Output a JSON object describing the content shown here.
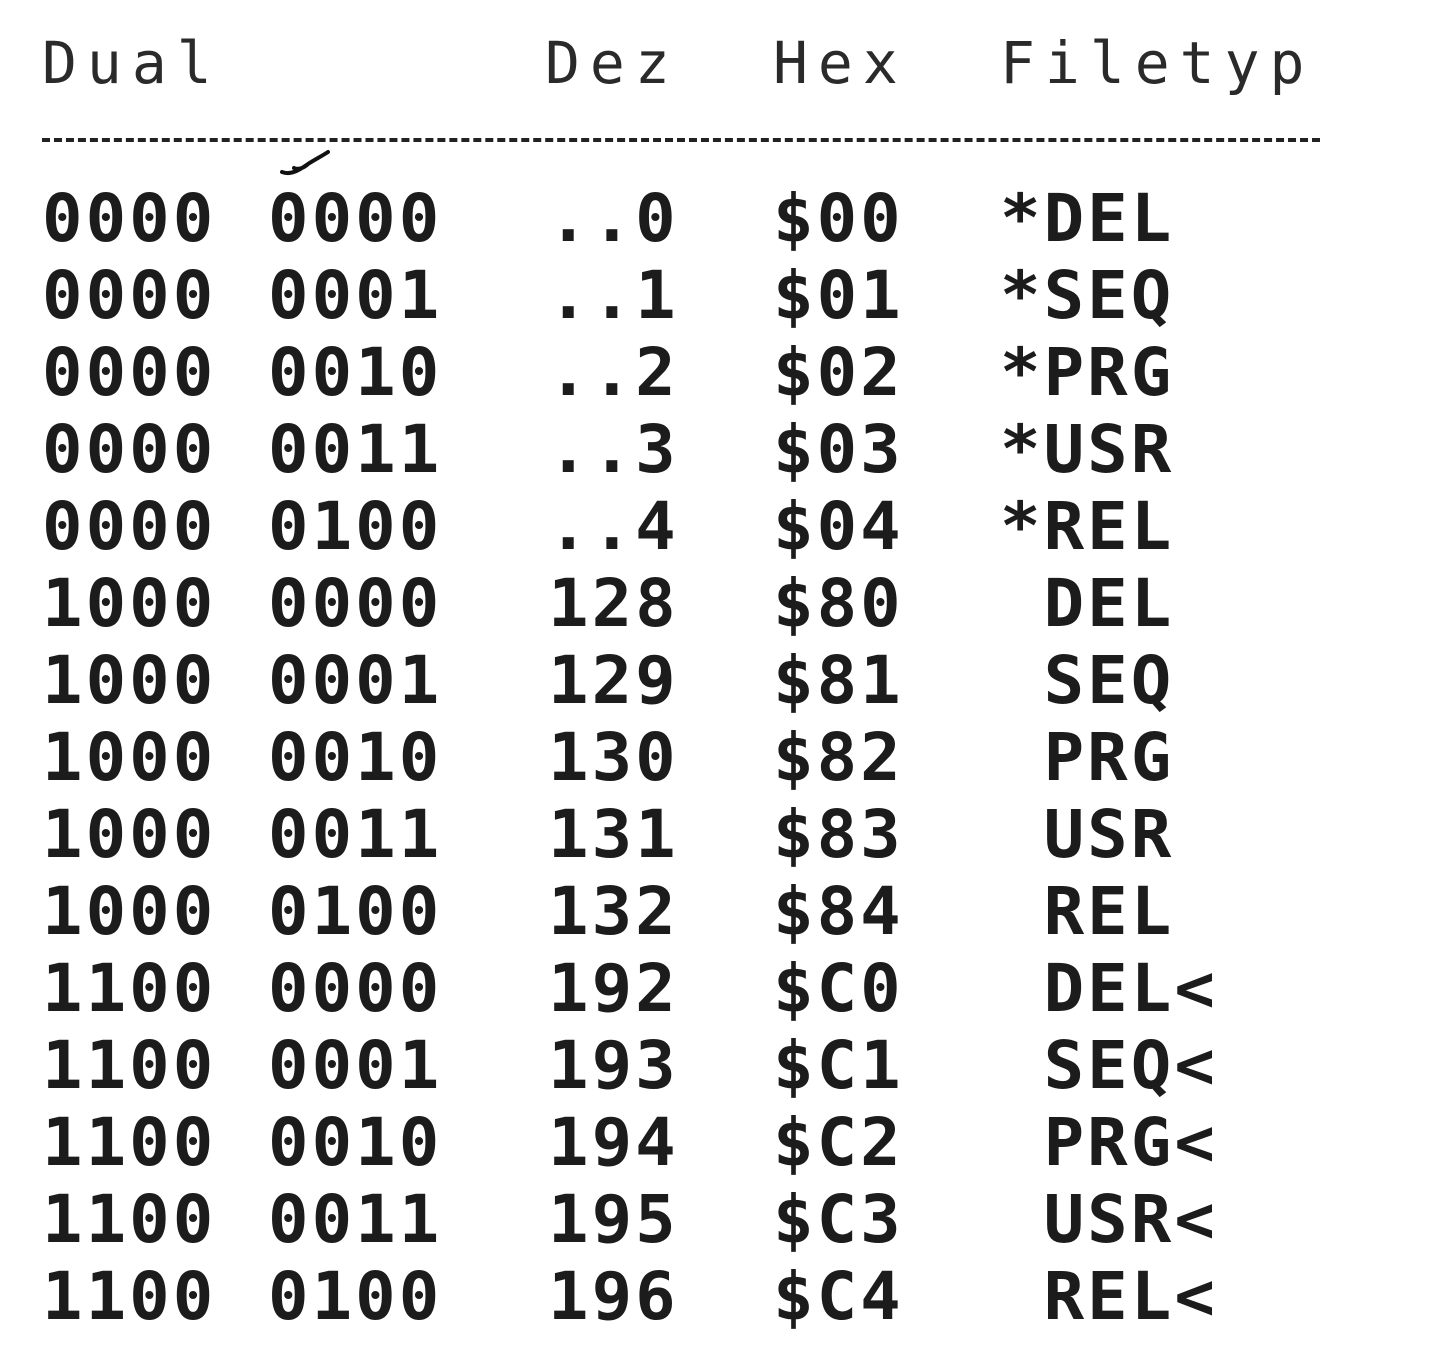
{
  "table": {
    "headers": {
      "dual": "Dual",
      "dez": "Dez",
      "hex": "Hex",
      "filetyp": "Filetyp"
    },
    "rows": [
      {
        "dual_hi": "0000",
        "dual_lo": "0000",
        "dez": "..0",
        "hex": "$00",
        "filetyp": "*DEL"
      },
      {
        "dual_hi": "0000",
        "dual_lo": "0001",
        "dez": "..1",
        "hex": "$01",
        "filetyp": "*SEQ"
      },
      {
        "dual_hi": "0000",
        "dual_lo": "0010",
        "dez": "..2",
        "hex": "$02",
        "filetyp": "*PRG"
      },
      {
        "dual_hi": "0000",
        "dual_lo": "0011",
        "dez": "..3",
        "hex": "$03",
        "filetyp": "*USR"
      },
      {
        "dual_hi": "0000",
        "dual_lo": "0100",
        "dez": "..4",
        "hex": "$04",
        "filetyp": "*REL"
      },
      {
        "dual_hi": "1000",
        "dual_lo": "0000",
        "dez": "128",
        "hex": "$80",
        "filetyp": " DEL"
      },
      {
        "dual_hi": "1000",
        "dual_lo": "0001",
        "dez": "129",
        "hex": "$81",
        "filetyp": " SEQ"
      },
      {
        "dual_hi": "1000",
        "dual_lo": "0010",
        "dez": "130",
        "hex": "$82",
        "filetyp": " PRG"
      },
      {
        "dual_hi": "1000",
        "dual_lo": "0011",
        "dez": "131",
        "hex": "$83",
        "filetyp": " USR"
      },
      {
        "dual_hi": "1000",
        "dual_lo": "0100",
        "dez": "132",
        "hex": "$84",
        "filetyp": " REL"
      },
      {
        "dual_hi": "1100",
        "dual_lo": "0000",
        "dez": "192",
        "hex": "$C0",
        "filetyp": " DEL<"
      },
      {
        "dual_hi": "1100",
        "dual_lo": "0001",
        "dez": "193",
        "hex": "$C1",
        "filetyp": " SEQ<"
      },
      {
        "dual_hi": "1100",
        "dual_lo": "0010",
        "dez": "194",
        "hex": "$C2",
        "filetyp": " PRG<"
      },
      {
        "dual_hi": "1100",
        "dual_lo": "0011",
        "dez": "195",
        "hex": "$C3",
        "filetyp": " USR<"
      },
      {
        "dual_hi": "1100",
        "dual_lo": "0100",
        "dez": "196",
        "hex": "$C4",
        "filetyp": " REL<"
      }
    ]
  }
}
